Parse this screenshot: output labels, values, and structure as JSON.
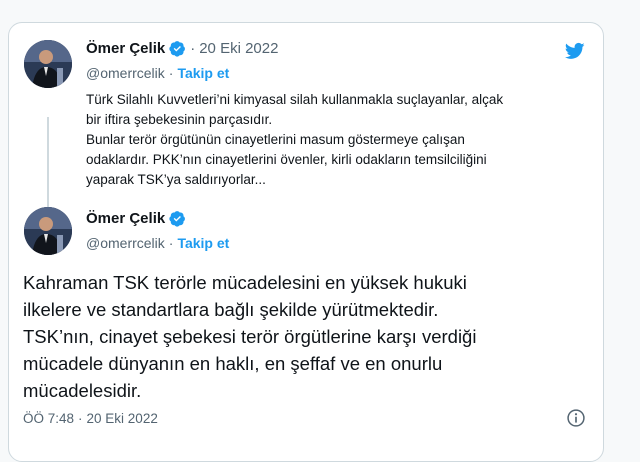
{
  "quoted_tweet": {
    "author_name": "Ömer Çelik",
    "separator": "·",
    "date": "20 Eki 2022",
    "handle": "@omerrcelik",
    "follow_label": "Takip et",
    "text_lines": [
      "Türk Silahlı Kuvvetleri’ni kimyasal silah kullanmakla suçlayanlar, alçak",
      "bir iftira şebekesinin parçasıdır.",
      "Bunlar terör örgütünün cinayetlerini masum göstermeye çalışan",
      "odaklardır. PKK’nın cinayetlerini övenler, kirli odakların temsilciliğini",
      "yaparak TSK’ya saldırıyorlar..."
    ]
  },
  "main_tweet": {
    "author_name": "Ömer Çelik",
    "handle": "@omerrcelik",
    "separator": "·",
    "follow_label": "Takip et",
    "text_lines": [
      "Kahraman TSK terörle mücadelesini en yüksek hukuki",
      "ilkelere ve standartlara bağlı şekilde yürütmektedir.",
      "TSK’nın, cinayet şebekesi terör örgütlerine karşı verdiği",
      "mücadele dünyanın en haklı, en şeffaf ve en onurlu",
      "mücadelesidir."
    ],
    "time": "ÖÖ 7:48",
    "time_separator": "·",
    "date": "20 Eki 2022"
  },
  "icons": {
    "brand": "twitter-bird-icon",
    "verified": "verified-badge-icon",
    "info": "info-icon"
  },
  "colors": {
    "accent": "#1d9bf0",
    "text": "#0f1419",
    "muted": "#536471",
    "border": "#cfd9de"
  }
}
